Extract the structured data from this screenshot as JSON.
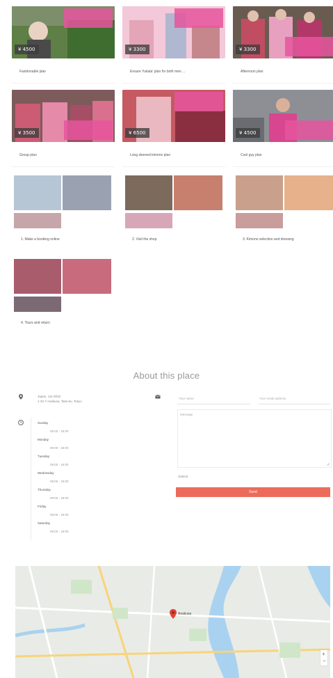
{
  "colors": {
    "accent": "#ec6b5a",
    "pink": "#e6559e",
    "price_bg": "#3c3c3c"
  },
  "plans": [
    {
      "caption": "Fashionable plan",
      "price": "¥ 4500"
    },
    {
      "caption": "Ensure Yukata' plan for both men ...",
      "price": "¥ 3300"
    },
    {
      "caption": "Afternoon plan",
      "price": "¥ 3300"
    },
    {
      "caption": "Group plan",
      "price": "¥ 3500"
    },
    {
      "caption": "Long sleeved kimono plan",
      "price": "¥ 6500"
    },
    {
      "caption": "Cool guy plan",
      "price": "¥ 4500"
    }
  ],
  "steps": [
    {
      "caption": "1. Make a booking online"
    },
    {
      "caption": "2. Visit the shop"
    },
    {
      "caption": "3. Kimono selection and dressing"
    },
    {
      "caption": "4. Tours and return"
    }
  ],
  "about": {
    "title": "About this place",
    "address_line1": "Japan, 111-0032",
    "address_line2": "1-32-7 Asakusa, Taito-ku, Tokyo",
    "hours_title": "Business Hours",
    "days": [
      {
        "day": "Sunday",
        "hours": "09:00 - 19:00"
      },
      {
        "day": "Monday",
        "hours": "09:00 - 19:00"
      },
      {
        "day": "Tuesday",
        "hours": "09:00 - 19:00"
      },
      {
        "day": "Wednesday",
        "hours": "09:00 - 19:00"
      },
      {
        "day": "Thursday",
        "hours": "09:00 - 19:00"
      },
      {
        "day": "Friday",
        "hours": "09:00 - 19:00"
      },
      {
        "day": "Saturday",
        "hours": "09:00 - 19:00"
      }
    ],
    "form": {
      "name_placeholder": "Your name",
      "email_placeholder": "Your email address",
      "message_placeholder": "Message",
      "captcha_label": "Submit",
      "submit_label": "Send"
    }
  },
  "map": {
    "pin_label": "Asakusa"
  }
}
